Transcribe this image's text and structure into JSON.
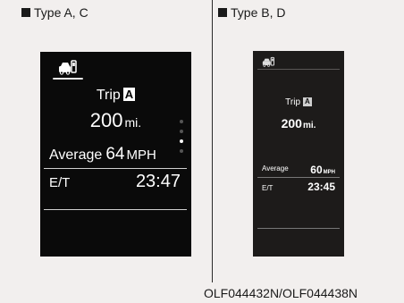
{
  "sections": {
    "left_header": "Type A, C",
    "right_header": "Type B, D"
  },
  "display_a": {
    "icon": "trip-computer-icon",
    "trip_label": "Trip",
    "trip_id": "A",
    "distance": "200",
    "distance_unit": "mi.",
    "avg_label": "Average",
    "avg_value": "64",
    "avg_unit": "MPH",
    "et_label": "E/T",
    "et_value": "23:47"
  },
  "display_b": {
    "icon": "trip-computer-icon",
    "trip_label": "Trip",
    "trip_id": "A",
    "distance": "200",
    "distance_unit": "mi.",
    "avg_label": "Average",
    "avg_value": "60",
    "avg_unit": "MPH",
    "et_label": "E/T",
    "et_value": "23:45"
  },
  "caption": "OLF044432N/OLF044438N",
  "colors": {
    "page_bg": "#f2efee",
    "screen_a_bg": "#0a0a0a",
    "screen_b_bg": "#1d1b1a"
  }
}
